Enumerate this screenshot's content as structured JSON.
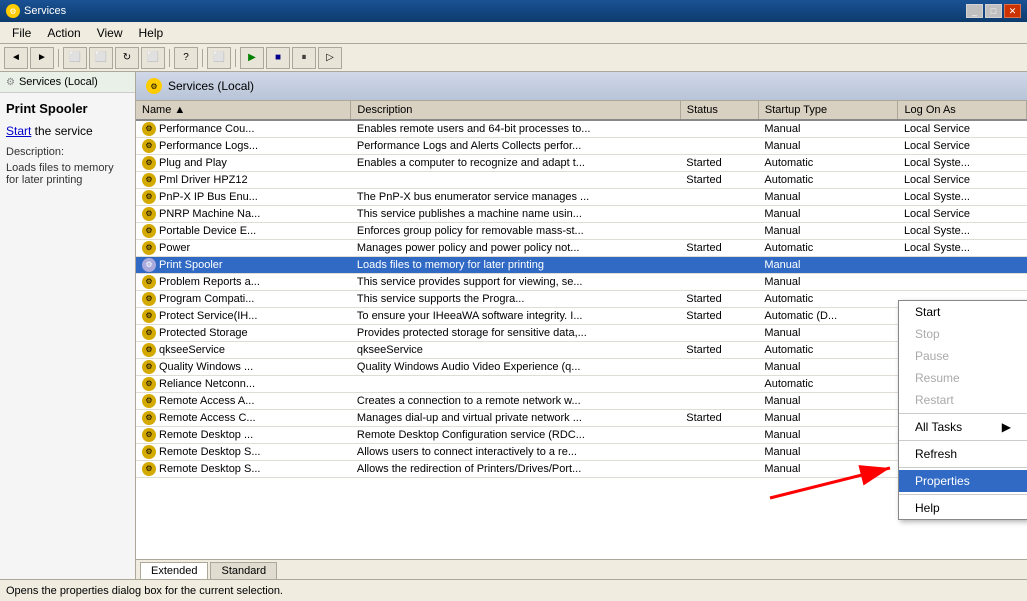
{
  "window": {
    "title": "Services",
    "icon": "⚙"
  },
  "menu": {
    "items": [
      "File",
      "Action",
      "View",
      "Help"
    ]
  },
  "toolbar": {
    "buttons": [
      "←",
      "→",
      "⬜",
      "⬜",
      "⬜",
      "⬜",
      "?",
      "⬜",
      "▶",
      "■",
      "⏸",
      "▷"
    ]
  },
  "sidebar": {
    "header": "Services (Local)",
    "panel_title": "Print Spooler",
    "link_text": "Start",
    "link_suffix": " the service",
    "desc_label": "Description:",
    "desc_text": "Loads files to memory for later printing"
  },
  "content_header": "Services (Local)",
  "table": {
    "columns": [
      "Name",
      "Description",
      "Status",
      "Startup Type",
      "Log On As"
    ],
    "rows": [
      {
        "name": "Performance Cou...",
        "desc": "Enables remote users and 64-bit processes to...",
        "status": "",
        "startup": "Manual",
        "logon": "Local Service"
      },
      {
        "name": "Performance Logs...",
        "desc": "Performance Logs and Alerts Collects perfor...",
        "status": "",
        "startup": "Manual",
        "logon": "Local Service"
      },
      {
        "name": "Plug and Play",
        "desc": "Enables a computer to recognize and adapt t...",
        "status": "Started",
        "startup": "Automatic",
        "logon": "Local Syste..."
      },
      {
        "name": "Pml Driver HPZ12",
        "desc": "",
        "status": "Started",
        "startup": "Automatic",
        "logon": "Local Service"
      },
      {
        "name": "PnP-X IP Bus Enu...",
        "desc": "The PnP-X bus enumerator service manages ...",
        "status": "",
        "startup": "Manual",
        "logon": "Local Syste..."
      },
      {
        "name": "PNRP Machine Na...",
        "desc": "This service publishes a machine name usin...",
        "status": "",
        "startup": "Manual",
        "logon": "Local Service"
      },
      {
        "name": "Portable Device E...",
        "desc": "Enforces group policy for removable mass-st...",
        "status": "",
        "startup": "Manual",
        "logon": "Local Syste..."
      },
      {
        "name": "Power",
        "desc": "Manages power policy and power policy not...",
        "status": "Started",
        "startup": "Automatic",
        "logon": "Local Syste..."
      },
      {
        "name": "Print Spooler",
        "desc": "Loads files to memory for later printing",
        "status": "",
        "startup": "Manual",
        "logon": "",
        "selected": true
      },
      {
        "name": "Problem Reports a...",
        "desc": "This service provides support for viewing, se...",
        "status": "",
        "startup": "Manual",
        "logon": ""
      },
      {
        "name": "Program Compati...",
        "desc": "This service supports the Progra...",
        "status": "Started",
        "startup": "Automatic",
        "logon": ""
      },
      {
        "name": "Protect Service(IH...",
        "desc": "To ensure your IHeeaWA software integrity. I...",
        "status": "Started",
        "startup": "Automatic (D...",
        "logon": ""
      },
      {
        "name": "Protected Storage",
        "desc": "Provides protected storage for sensitive data,...",
        "status": "",
        "startup": "Manual",
        "logon": ""
      },
      {
        "name": "qkseeService",
        "desc": "qkseeService",
        "status": "Started",
        "startup": "Automatic",
        "logon": ""
      },
      {
        "name": "Quality Windows ...",
        "desc": "Quality Windows Audio Video Experience (q...",
        "status": "",
        "startup": "Manual",
        "logon": ""
      },
      {
        "name": "Reliance Netconn...",
        "desc": "",
        "status": "",
        "startup": "Automatic",
        "logon": ""
      },
      {
        "name": "Remote Access A...",
        "desc": "Creates a connection to a remote network w...",
        "status": "",
        "startup": "Manual",
        "logon": ""
      },
      {
        "name": "Remote Access C...",
        "desc": "Manages dial-up and virtual private network ...",
        "status": "Started",
        "startup": "Manual",
        "logon": ""
      },
      {
        "name": "Remote Desktop ...",
        "desc": "Remote Desktop Configuration service (RDC...",
        "status": "",
        "startup": "Manual",
        "logon": ""
      },
      {
        "name": "Remote Desktop S...",
        "desc": "Allows users to connect interactively to a re...",
        "status": "",
        "startup": "Manual",
        "logon": ""
      },
      {
        "name": "Remote Desktop S...",
        "desc": "Allows the redirection of Printers/Drives/Port...",
        "status": "",
        "startup": "Manual",
        "logon": ""
      }
    ]
  },
  "context_menu": {
    "items": [
      {
        "label": "Start",
        "disabled": false
      },
      {
        "label": "Stop",
        "disabled": true
      },
      {
        "label": "Pause",
        "disabled": true
      },
      {
        "label": "Resume",
        "disabled": true
      },
      {
        "label": "Restart",
        "disabled": true
      },
      {
        "separator": true
      },
      {
        "label": "All Tasks",
        "has_arrow": true,
        "disabled": false
      },
      {
        "separator": true
      },
      {
        "label": "Refresh",
        "disabled": false
      },
      {
        "separator": true
      },
      {
        "label": "Properties",
        "highlighted": true,
        "disabled": false
      },
      {
        "separator": true
      },
      {
        "label": "Help",
        "disabled": false
      }
    ]
  },
  "tabs": [
    {
      "label": "Extended",
      "active": true
    },
    {
      "label": "Standard",
      "active": false
    }
  ],
  "status_bar": {
    "text": "Opens the properties dialog box for the current selection."
  }
}
